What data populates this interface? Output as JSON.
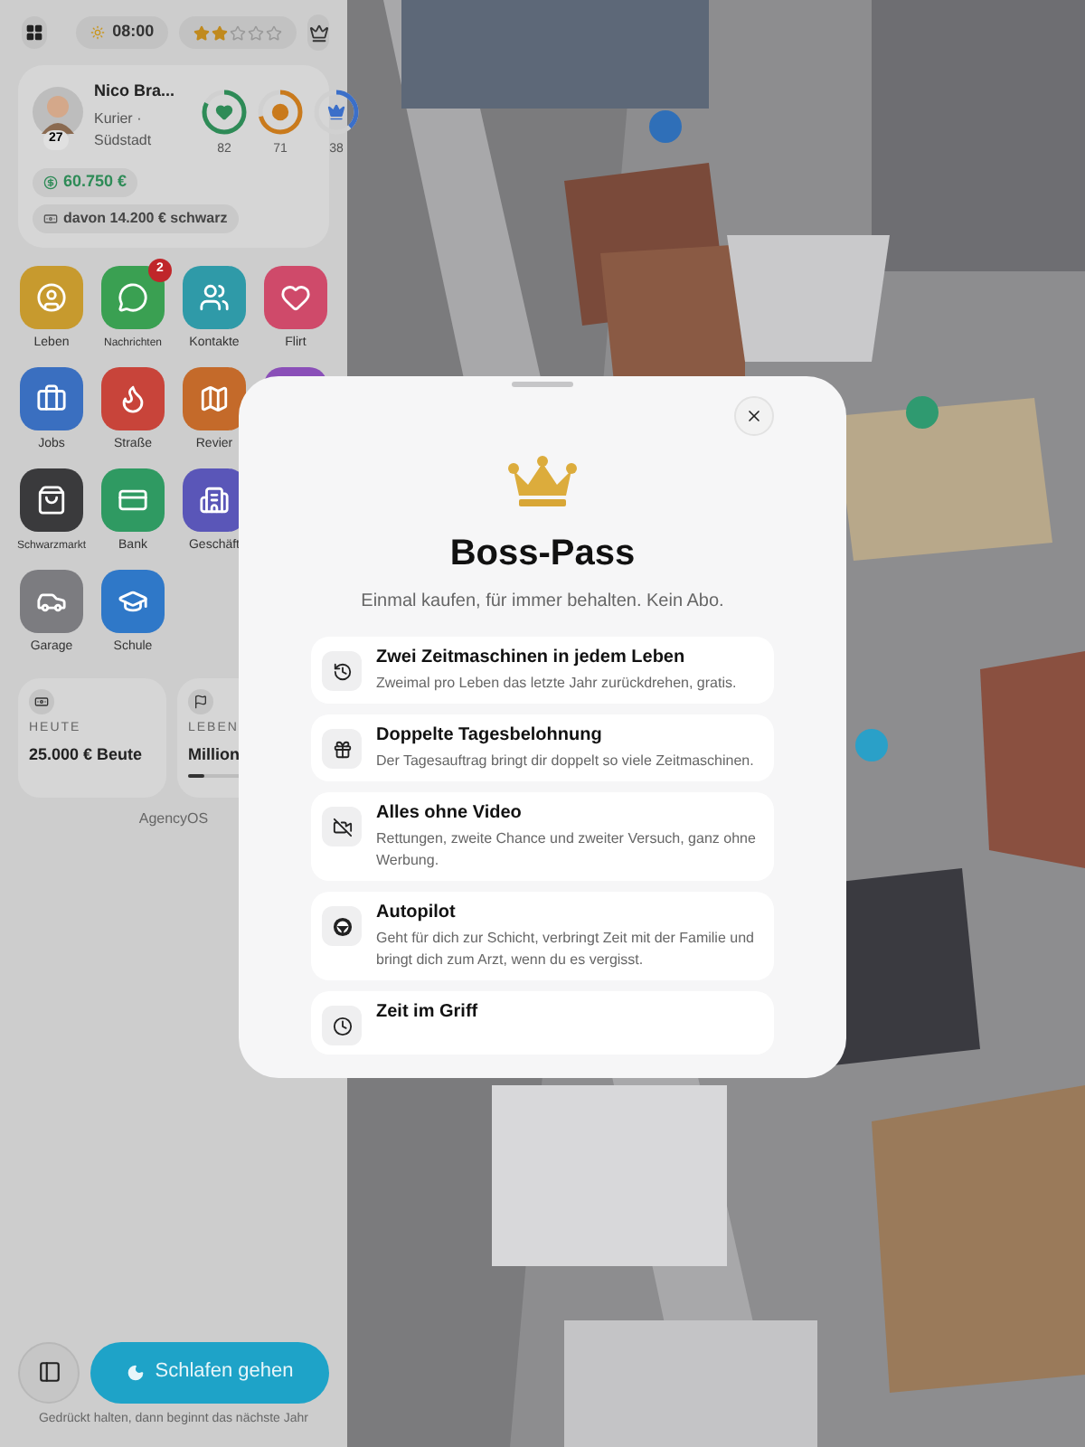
{
  "topbar": {
    "time": "08:00",
    "stars": 2
  },
  "profile": {
    "name": "Nico Bra...",
    "role": "Kurier ·",
    "district": "Südstadt",
    "age": "27",
    "stats": [
      {
        "value": "82",
        "level": 0.82,
        "color": "#2e8b57"
      },
      {
        "value": "71",
        "level": 0.71,
        "color": "#c97a1c"
      },
      {
        "value": "38",
        "level": 0.38,
        "color": "#3b6fc9"
      }
    ],
    "money": "60.750 €",
    "black_money": "davon 14.200 € schwarz"
  },
  "app_rows": [
    [
      {
        "label": "Leben",
        "color": "#c79a2e"
      },
      {
        "label": "Nachrichten",
        "color": "#3aa052",
        "badge": "2"
      },
      {
        "label": "Kontakte",
        "color": "#2f9aa8"
      },
      {
        "label": "Flirt",
        "color": "#cf4a6a"
      }
    ],
    [
      {
        "label": "Jobs",
        "color": "#3a6fc0"
      },
      {
        "label": "Straße",
        "color": "#c8443a"
      },
      {
        "label": "Revier",
        "color": "#c46a2a"
      },
      {
        "color": "#8a4fb8"
      }
    ],
    [
      {
        "label": "Schwarzmarkt",
        "color": "#3a3a3c"
      },
      {
        "label": "Bank",
        "color": "#2f9a62"
      },
      {
        "label": "Geschäft",
        "color": "#5a56b8"
      }
    ],
    [
      {
        "label": "Garage",
        "color": "#7c7c80"
      },
      {
        "label": "Schule",
        "color": "#2f78c8"
      }
    ]
  ],
  "cards": [
    {
      "label": "HEUTE",
      "value": "25.000 € Beute"
    },
    {
      "label": "LEBEN",
      "value": "Million",
      "level": 0.15
    }
  ],
  "footer_brand": "AgencyOS",
  "sleep": {
    "label": "Schlafen gehen",
    "hint": "Gedrückt halten, dann beginnt das nächste Jahr"
  },
  "modal": {
    "title": "Boss-Pass",
    "subtitle": "Einmal kaufen, für immer behalten. Kein Abo.",
    "features": [
      {
        "title": "Zwei Zeitmaschinen in jedem Leben",
        "text": "Zweimal pro Leben das letzte Jahr zurückdrehen, gratis."
      },
      {
        "title": "Doppelte Tagesbelohnung",
        "text": "Der Tagesauftrag bringt dir doppelt so viele Zeitmaschinen."
      },
      {
        "title": "Alles ohne Video",
        "text": "Rettungen, zweite Chance und zweiter Versuch, ganz ohne Werbung."
      },
      {
        "title": "Autopilot",
        "text": "Geht für dich zur Schicht, verbringt Zeit mit der Familie und bringt dich zum Arzt, wenn du es vergisst."
      },
      {
        "title": "Zeit im Griff"
      }
    ]
  }
}
